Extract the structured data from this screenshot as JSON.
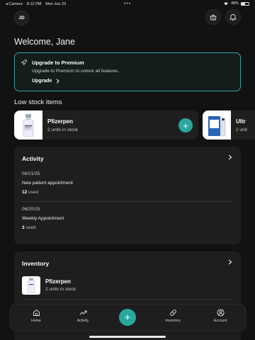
{
  "status_bar": {
    "back_app": "◂ Camera",
    "time": "8:12 PM",
    "date": "Mon Jun 23",
    "battery": "48%"
  },
  "header": {
    "avatar_initials": "JD",
    "welcome": "Welcome, Jane"
  },
  "premium": {
    "title": "Upgrade to Premium",
    "description": "Upgrade to Premium to unlock all features.",
    "link": "Upgrade",
    "accent": "#2aa7a1"
  },
  "low_stock": {
    "title": "Low stock items",
    "items": [
      {
        "name": "Pfizerpen",
        "qty": "2 units in stock"
      },
      {
        "name": "Ultr",
        "qty": "2 unit"
      }
    ]
  },
  "activity": {
    "title": "Activity",
    "entries": [
      {
        "date": "06/21/25",
        "title": "New patient appointment",
        "count": "12",
        "suffix": "used"
      },
      {
        "date": "06/20/25",
        "title": "Weekly Appointment",
        "count": "3",
        "suffix": "used"
      }
    ]
  },
  "inventory": {
    "title": "Inventory",
    "items": [
      {
        "name": "Pfizerpen",
        "qty": "2 units in stock"
      }
    ]
  },
  "tabs": {
    "home": "Home",
    "activity": "Activity",
    "inventory": "Inventory",
    "account": "Account",
    "fab": "+"
  }
}
